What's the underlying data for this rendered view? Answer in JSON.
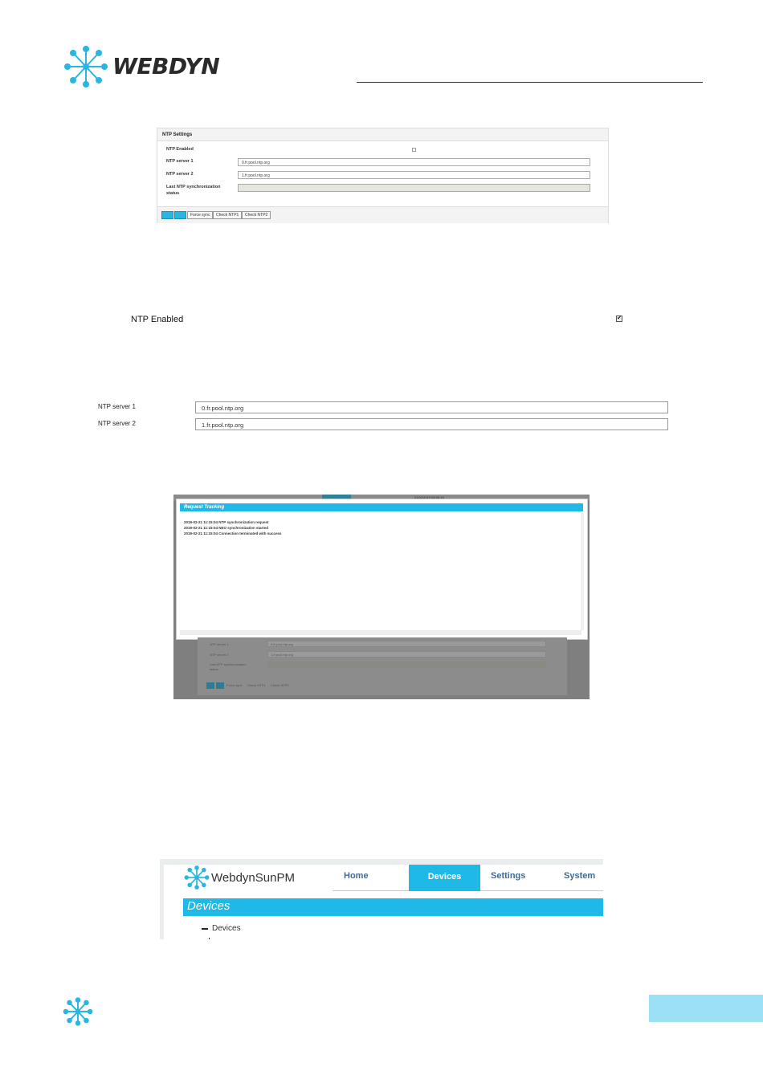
{
  "header": {
    "brand": "WEBDYN"
  },
  "ntp_panel": {
    "title": "NTP Settings",
    "enabled_label": "NTP Enabled",
    "server1_label": "NTP server 1",
    "server1_value": "0.fr.pool.ntp.org",
    "server2_label": "NTP server 2",
    "server2_value": "1.fr.pool.ntp.org",
    "last_sync_label_1": "Last NTP synchronization",
    "last_sync_label_2": "status",
    "buttons": {
      "force_sync": "Force sync",
      "check1": "Check NTP1",
      "check2": "Check NTP2"
    }
  },
  "ntp_enabled": {
    "label": "NTP Enabled",
    "checked": true,
    "check_mark": "✔"
  },
  "servers": {
    "server1_label": "NTP server 1",
    "server1_value": "0.fr.pool.ntp.org",
    "server2_label": "NTP server 2",
    "server2_value": "1.fr.pool.ntp.org"
  },
  "request_tracking": {
    "title": "Request Tracking",
    "lines": [
      "2019-02-21 11:15:04 NTP synchronization request",
      "2019-02-21 11:15:04 NEO synchronization started",
      "2019-02-21 11:15:04 Connection terminated with success"
    ],
    "bg_date": "21/02/2019 08:08:18",
    "bg_server1_label": "NTP server 1",
    "bg_server1_value": "0.fr.pool.ntp.org",
    "bg_server2_label": "NTP server 2",
    "bg_server2_value": "1.fr.pool.ntp.org",
    "bg_last_sync_1": "Last NTP synchronization",
    "bg_last_sync_2": "status",
    "bg_buttons": {
      "force_sync": "Force sync",
      "check1": "Check NTP1",
      "check2": "Check NTP2"
    }
  },
  "nav": {
    "brand": "WebdynSunPM",
    "tabs": [
      {
        "label": "Home",
        "active": false
      },
      {
        "label": "Devices",
        "active": true
      },
      {
        "label": "Settings",
        "active": false
      },
      {
        "label": "System",
        "active": false
      }
    ],
    "section_title": "Devices",
    "tree_item": "Devices"
  },
  "colors": {
    "accent": "#1fb9e8",
    "nav_text": "#3e6b99"
  }
}
